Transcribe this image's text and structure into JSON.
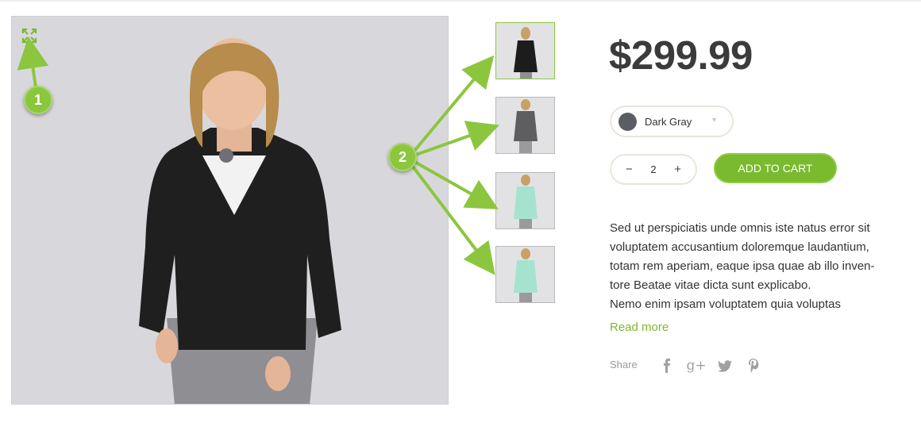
{
  "product": {
    "price": "$299.99",
    "color": {
      "label": "Dark Gray",
      "swatch": "#5a5d63"
    },
    "quantity": "2",
    "qty_minus": "−",
    "qty_plus": "+",
    "add_to_cart": "ADD TO CART",
    "description_lines": [
      "Sed ut perspiciatis unde omnis iste natus error sit",
      "voluptatem accusantium doloremque laudantium,",
      "totam rem aperiam, eaque ipsa quae ab illo inven-",
      "tore Beatae vitae dicta sunt explicabo.",
      "Nemo enim ipsam voluptatem quia voluptas"
    ],
    "read_more": "Read more",
    "share_label": "Share",
    "social": [
      {
        "icon": "facebook-icon",
        "glyph": "f"
      },
      {
        "icon": "google-plus-icon",
        "glyph": "g+"
      },
      {
        "icon": "twitter-icon",
        "glyph": "t"
      },
      {
        "icon": "pinterest-icon",
        "glyph": "p"
      }
    ]
  },
  "callouts": {
    "one": "1",
    "two": "2"
  },
  "colors": {
    "accent": "#79ba2f",
    "callout": "#8cc63f",
    "price": "#3b3b3b"
  },
  "gallery": {
    "thumbnails": [
      {
        "name": "thumb-black-cardigan-front",
        "garment": "#1c1c1c",
        "active": true
      },
      {
        "name": "thumb-gray-cardigan-back",
        "garment": "#5e5e60",
        "active": false
      },
      {
        "name": "thumb-mint-cardigan-front",
        "garment": "#a6e3cf",
        "active": false
      },
      {
        "name": "thumb-mint-cardigan-back",
        "garment": "#a6e3cf",
        "active": false
      }
    ]
  }
}
